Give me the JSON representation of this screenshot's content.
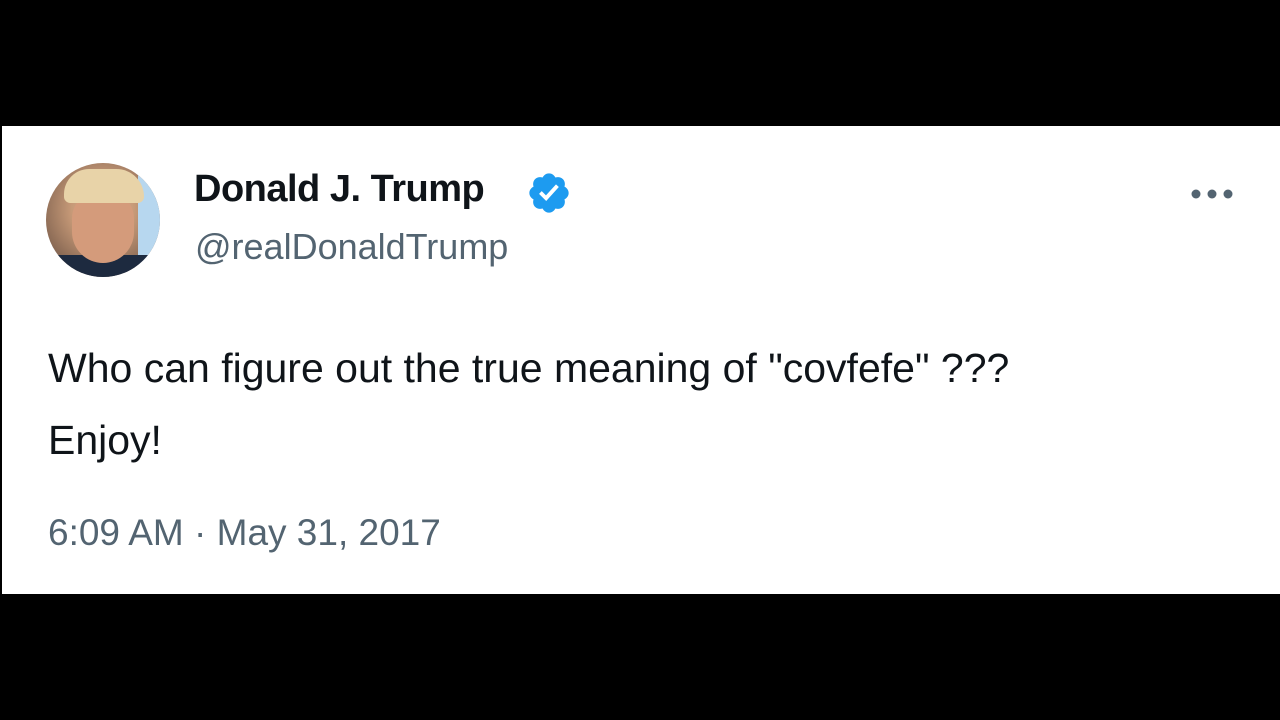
{
  "tweet": {
    "author": {
      "display_name": "Donald J. Trump",
      "handle": "@realDonaldTrump",
      "verified": true,
      "verified_color": "#1d9bf0"
    },
    "text": "Who can figure out the true meaning of \"covfefe\" ???\nEnjoy!",
    "timestamp": "6:09 AM · May 31, 2017",
    "more_icon": "more-horizontal-icon"
  },
  "colors": {
    "background": "#000000",
    "card": "#ffffff",
    "primary_text": "#0f1419",
    "secondary_text": "#536471",
    "accent": "#1d9bf0"
  }
}
